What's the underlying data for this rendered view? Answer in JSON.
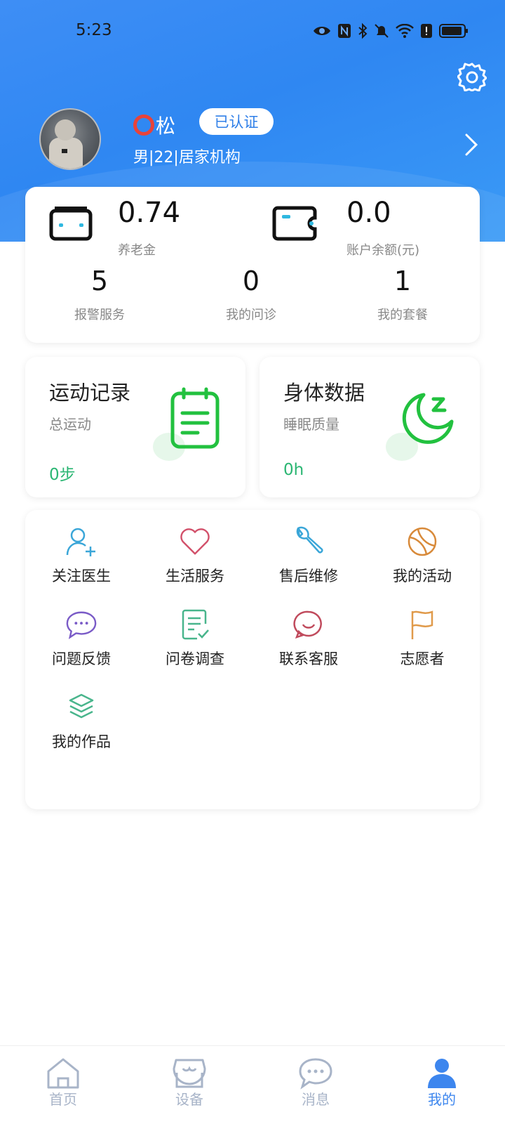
{
  "status_bar": {
    "time": "5:23"
  },
  "profile": {
    "name": "松",
    "verified_label": "已认证",
    "meta": "男|22|居家机构"
  },
  "account": {
    "pension_value": "0.74",
    "pension_label": "养老金",
    "balance_value": "0.0",
    "balance_label": "账户余额(元)",
    "stats": [
      {
        "value": "5",
        "label": "报警服务"
      },
      {
        "value": "0",
        "label": "我的问诊"
      },
      {
        "value": "1",
        "label": "我的套餐"
      }
    ]
  },
  "records": [
    {
      "title": "运动记录",
      "subtitle": "总运动",
      "value": "0步",
      "icon": "clipboard-icon"
    },
    {
      "title": "身体数据",
      "subtitle": "睡眠质量",
      "value": "0h",
      "icon": "moon-sleep-icon"
    }
  ],
  "services": [
    {
      "label": "关注医生",
      "icon": "add-user-icon",
      "color": "#3aa6d8"
    },
    {
      "label": "生活服务",
      "icon": "heart-icon",
      "color": "#d2506a"
    },
    {
      "label": "售后维修",
      "icon": "wrench-icon",
      "color": "#3aa6d8"
    },
    {
      "label": "我的活动",
      "icon": "ball-icon",
      "color": "#d88a3a"
    },
    {
      "label": "问题反馈",
      "icon": "chat-bubble-icon",
      "color": "#7a5bc7"
    },
    {
      "label": "问卷调查",
      "icon": "checklist-icon",
      "color": "#49b58c"
    },
    {
      "label": "联系客服",
      "icon": "smile-icon",
      "color": "#c04a5c"
    },
    {
      "label": "志愿者",
      "icon": "flag-icon",
      "color": "#e09a4a"
    },
    {
      "label": "我的作品",
      "icon": "layers-icon",
      "color": "#49b58c"
    }
  ],
  "tabs": [
    {
      "label": "首页",
      "icon": "home-icon"
    },
    {
      "label": "设备",
      "icon": "store-icon"
    },
    {
      "label": "消息",
      "icon": "message-icon"
    },
    {
      "label": "我的",
      "icon": "person-icon",
      "active": true
    }
  ],
  "colors": {
    "primary": "#3d86ee",
    "accent_green": "#2bb673"
  }
}
